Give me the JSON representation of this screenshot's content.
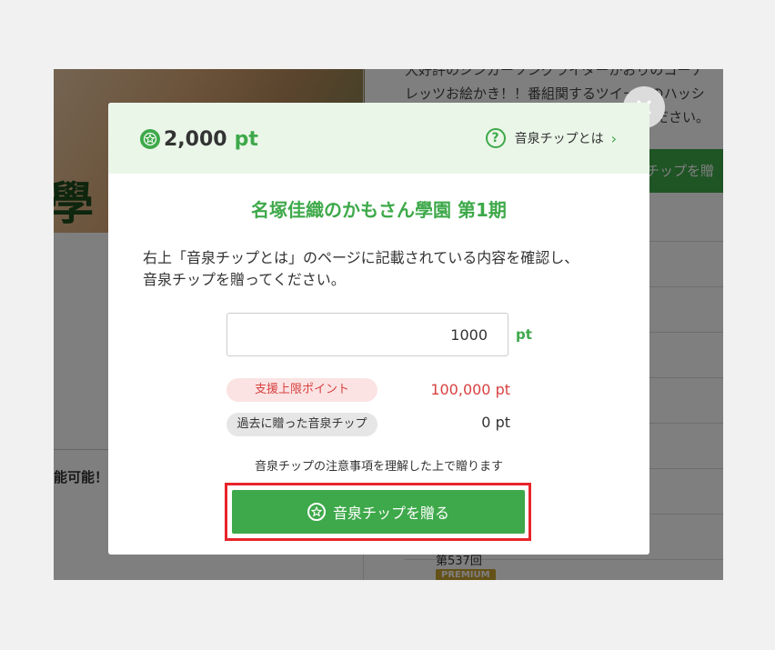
{
  "background": {
    "hero_char": "學",
    "description_lines": [
      "大好評のシンガーソングライターかおりのコーナ",
      "レッツお絵かき！！番組関するツイートのハッシ",
      "ください。"
    ],
    "green_button_label": "チップを贈",
    "left_text": "能可能！",
    "episode": "第537回",
    "premium_badge": "PREMIUM"
  },
  "modal": {
    "points_value": "2,000",
    "points_unit": "pt",
    "help_link_label": "音泉チップとは",
    "title": "名塚佳織のかもさん學園 第1期",
    "instruction_lines": [
      "右上「音泉チップとは」のページに記載されている内容を確認し、",
      "音泉チップを贈ってください。"
    ],
    "amount_value": "1000",
    "amount_unit": "pt",
    "limit_label": "支援上限ポイント",
    "limit_value": "100,000 pt",
    "past_label": "過去に贈った音泉チップ",
    "past_value": "0 pt",
    "notice": "音泉チップの注意事項を理解した上で贈ります",
    "send_button_label": "音泉チップを贈る"
  },
  "colors": {
    "accent_green": "#3ea94a",
    "limit_red": "#d94040",
    "highlight_red": "#e8242b"
  },
  "icons": {
    "points": "star-coin-icon",
    "help": "question-circle-icon",
    "chevron": "chevron-right-icon",
    "close": "close-icon",
    "button": "star-coin-icon"
  }
}
